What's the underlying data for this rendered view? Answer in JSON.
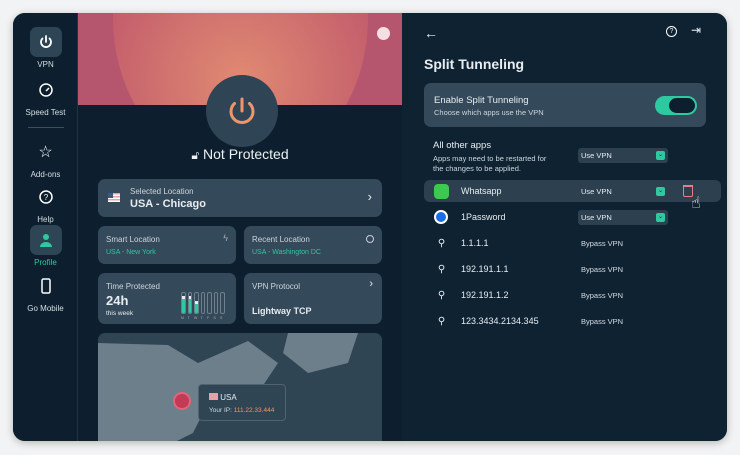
{
  "sidebar": {
    "items": [
      {
        "label": "VPN",
        "icon": "power-icon",
        "active": true
      },
      {
        "label": "Speed Test",
        "icon": "speedometer-icon"
      },
      {
        "label": "Add-ons",
        "icon": "star-icon"
      },
      {
        "label": "Help",
        "icon": "help-icon"
      },
      {
        "label": "Profile",
        "icon": "person-icon",
        "accent": true
      },
      {
        "label": "Go Mobile",
        "icon": "phone-icon"
      }
    ]
  },
  "main": {
    "status": "Not Protected",
    "selected": {
      "label": "Selected Location",
      "value": "USA - Chicago"
    },
    "smart": {
      "label": "Smart Location",
      "value": "USA - New York"
    },
    "recent": {
      "label": "Recent Location",
      "value": "USA - Washington DC"
    },
    "time": {
      "label": "Time Protected",
      "value": "24h",
      "sub": "this week",
      "days": [
        "M",
        "T",
        "W",
        "T",
        "F",
        "S",
        "S"
      ],
      "fill": [
        0.85,
        0.85,
        0.6,
        0,
        0,
        0,
        0
      ]
    },
    "protocol": {
      "label": "VPN Protocol",
      "value": "Lightway TCP"
    },
    "map": {
      "country": "USA",
      "ip_label": "Your IP:",
      "ip": "111.22.33.444"
    }
  },
  "split": {
    "title": "Split Tunneling",
    "enable": {
      "title": "Enable Split Tunneling",
      "sub": "Choose which apps use the VPN",
      "on": true
    },
    "all": {
      "title": "All other apps",
      "sub1": "Apps may need to be restarted for",
      "sub2": "the changes to be applied.",
      "value": "Use VPN"
    },
    "rows": [
      {
        "name": "Whatsapp",
        "value": "Use VPN",
        "icon": "whatsapp-icon"
      },
      {
        "name": "1Password",
        "value": "Use VPN",
        "icon": "1password-icon"
      },
      {
        "name": "1.1.1.1",
        "value": "Bypass VPN"
      },
      {
        "name": "192.191.1.1",
        "value": "Bypass VPN"
      },
      {
        "name": "192.191.1.2",
        "value": "Bypass VPN"
      },
      {
        "name": "123.3434.2134.345",
        "value": "Bypass VPN"
      }
    ]
  },
  "colors": {
    "accent": "#2ec9a0",
    "power": "#f0956a",
    "card": "#34495a",
    "bg": "#0d1f2e"
  }
}
